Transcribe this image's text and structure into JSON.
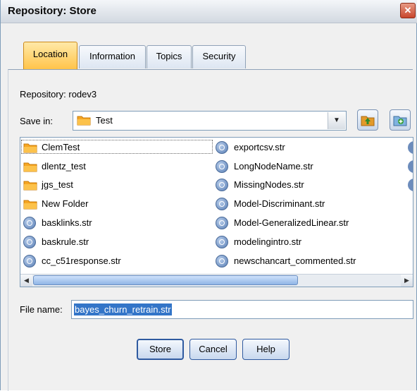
{
  "window": {
    "title": "Repository: Store",
    "close_glyph": "✕"
  },
  "tabs": [
    {
      "label": "Location",
      "active": true
    },
    {
      "label": "Information",
      "active": false
    },
    {
      "label": "Topics",
      "active": false
    },
    {
      "label": "Security",
      "active": false
    }
  ],
  "repository_label": "Repository: rodev3",
  "save_in": {
    "label": "Save in:",
    "value": "Test"
  },
  "files": {
    "col1": [
      {
        "name": "ClemTest",
        "icon": "folder-icon"
      },
      {
        "name": "dlentz_test",
        "icon": "folder-icon"
      },
      {
        "name": "jgs_test",
        "icon": "folder-icon"
      },
      {
        "name": "New Folder",
        "icon": "folder-icon"
      },
      {
        "name": "basklinks.str",
        "icon": "stream-file-icon"
      },
      {
        "name": "baskrule.str",
        "icon": "stream-file-icon"
      },
      {
        "name": "cc_c51response.str",
        "icon": "stream-file-icon"
      }
    ],
    "col2": [
      {
        "name": "exportcsv.str",
        "icon": "stream-file-icon"
      },
      {
        "name": "LongNodeName.str",
        "icon": "stream-file-icon"
      },
      {
        "name": "MissingNodes.str",
        "icon": "stream-file-icon"
      },
      {
        "name": "Model-Discriminant.str",
        "icon": "stream-file-icon"
      },
      {
        "name": "Model-GeneralizedLinear.str",
        "icon": "stream-file-icon"
      },
      {
        "name": "modelingintro.str",
        "icon": "stream-file-icon"
      },
      {
        "name": "newschancart_commented.str",
        "icon": "stream-file-icon"
      }
    ]
  },
  "file_name": {
    "label": "File name:",
    "value": "bayes_churn_retrain.str"
  },
  "buttons": {
    "store": "Store",
    "cancel": "Cancel",
    "help": "Help"
  },
  "colors": {
    "active_tab": "#ffc44a",
    "selection": "#3375c8",
    "border": "#7f9db9"
  }
}
